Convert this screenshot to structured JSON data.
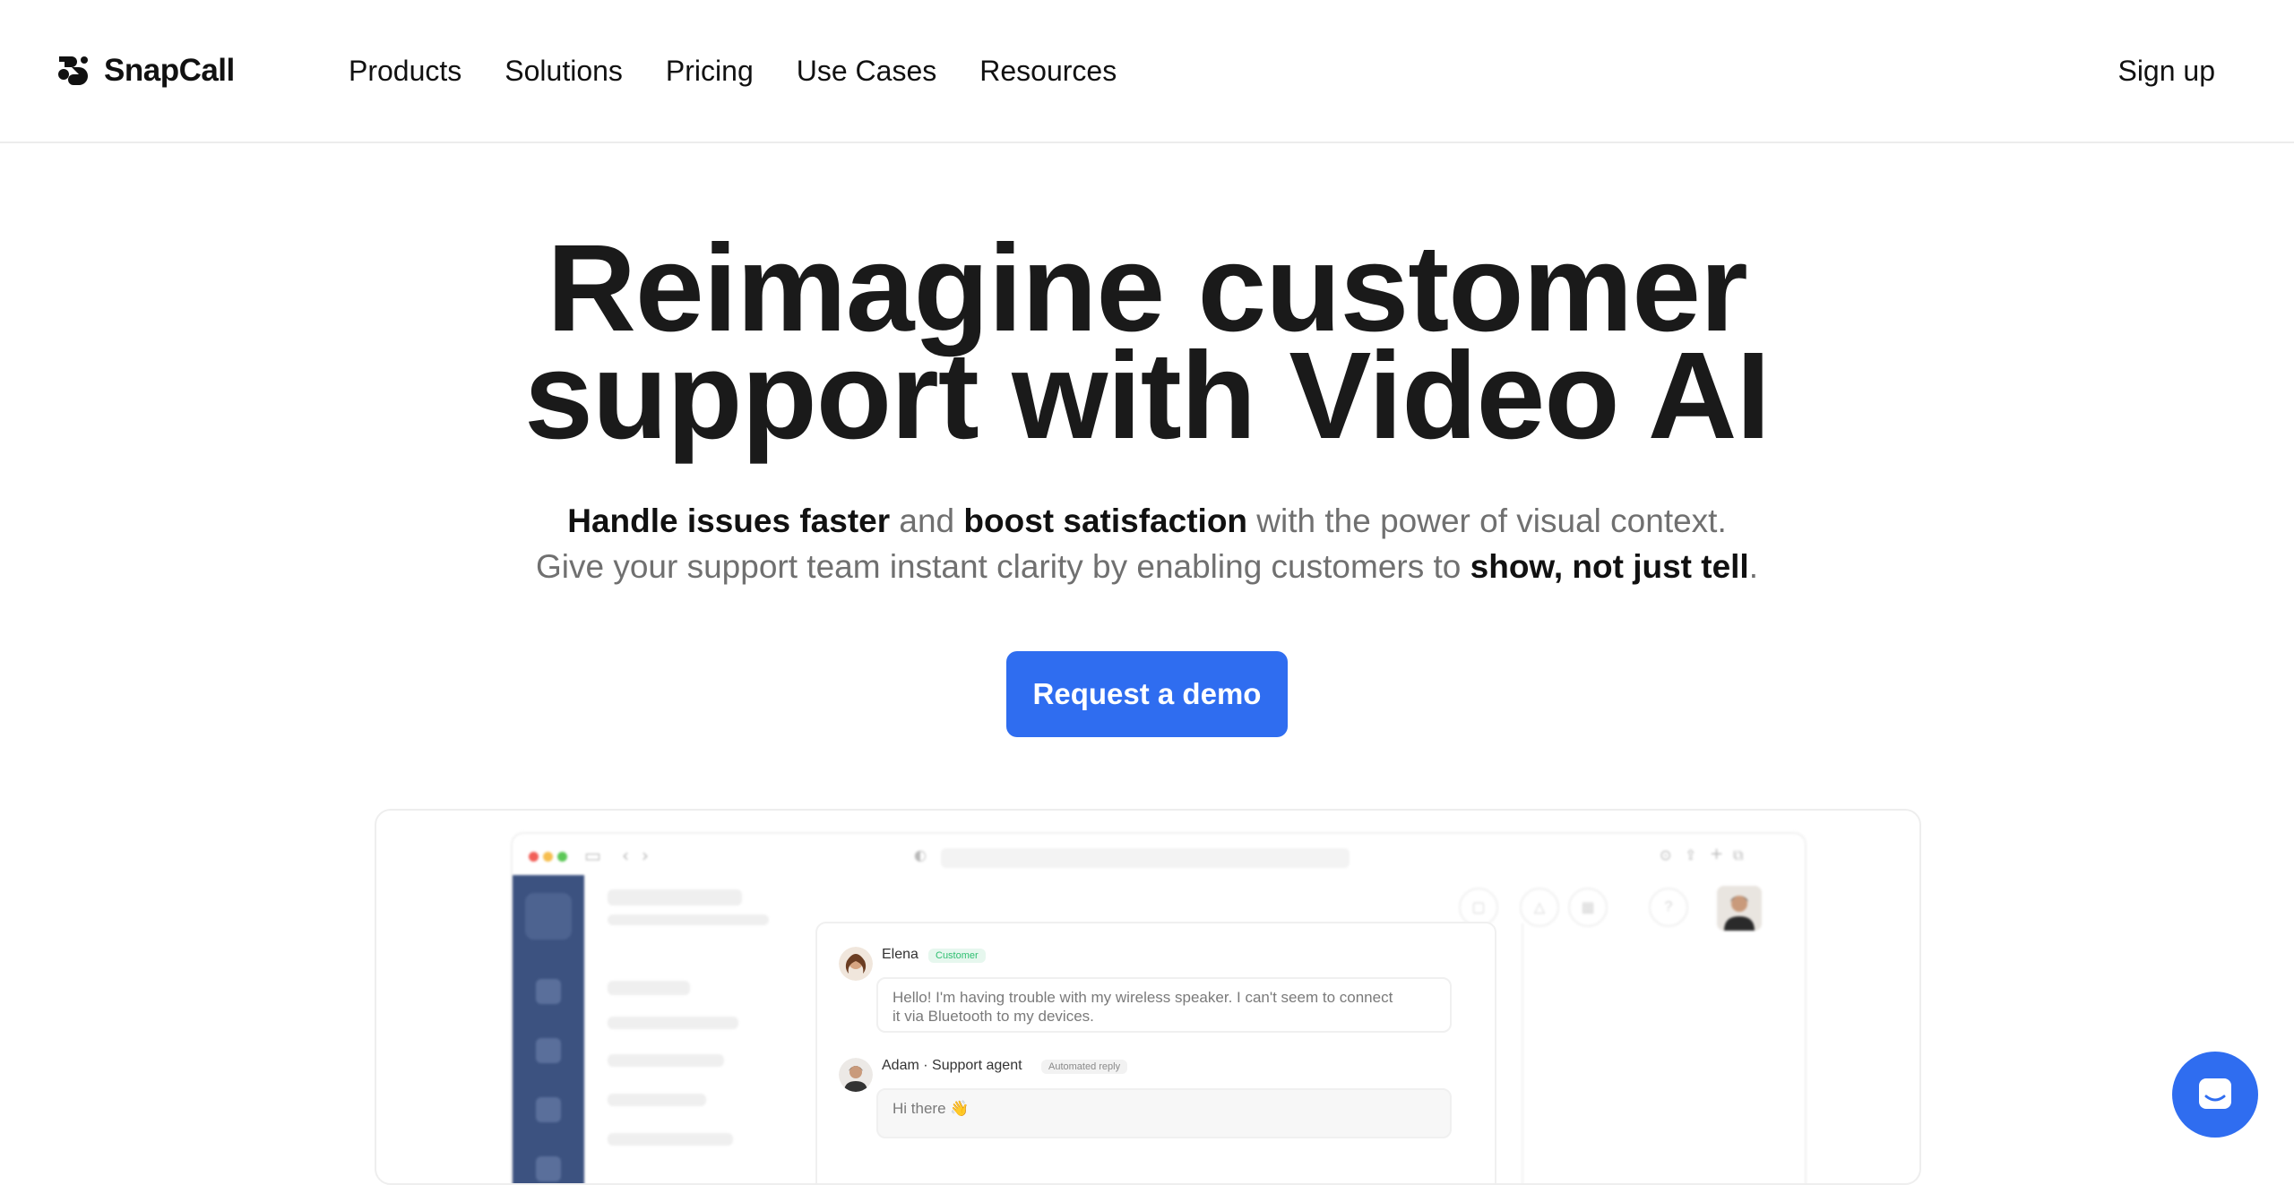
{
  "header": {
    "brand": "SnapCall",
    "nav": [
      "Products",
      "Solutions",
      "Pricing",
      "Use Cases",
      "Resources"
    ],
    "signup": "Sign up"
  },
  "hero": {
    "title_line1": "Reimagine customer",
    "title_line2": "support with Video AI",
    "sub1": {
      "a": "Handle issues faster",
      "b": " and ",
      "c": "boost satisfaction",
      "d": " with the power of visual context."
    },
    "sub2": {
      "a": "Give your support team instant clarity by enabling customers to ",
      "b": "show, not just tell",
      "c": "."
    },
    "cta": "Request a demo"
  },
  "mockup": {
    "messages": [
      {
        "name": "Elena",
        "badge": "Customer",
        "text_line1": "Hello! I'm having trouble with my wireless speaker. I can't seem to connect",
        "text_line2": "it via Bluetooth to my devices."
      },
      {
        "name": "Adam · Support agent",
        "badge": "Automated reply",
        "text_line1": "Hi there 👋"
      }
    ]
  },
  "colors": {
    "accent": "#2f6df0",
    "rail": "#3c5280",
    "badge_customer": "#2fbf71"
  },
  "icons": {
    "launcher": "chat-bubble-icon",
    "logo": "snapcall-logo-icon"
  }
}
